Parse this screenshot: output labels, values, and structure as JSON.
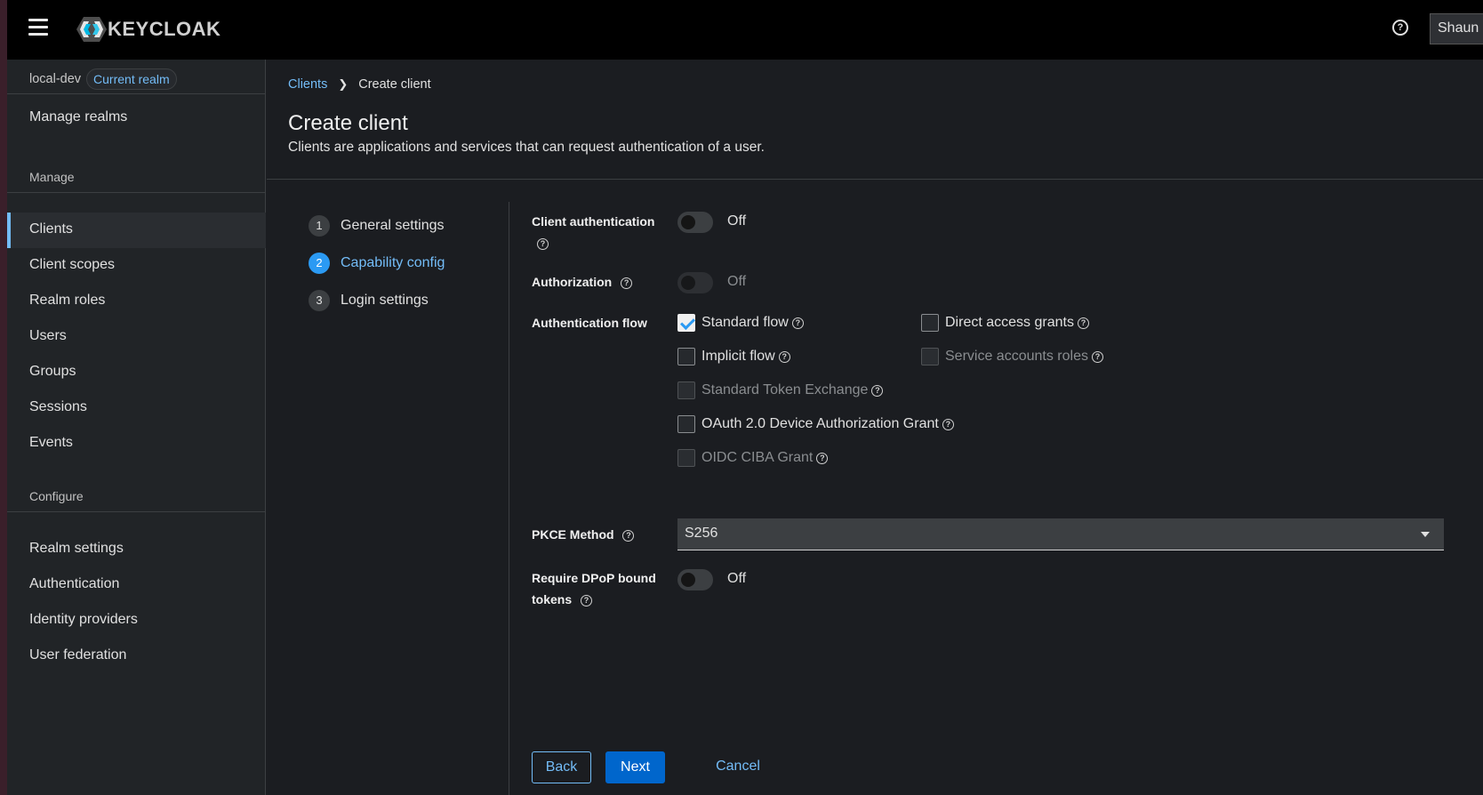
{
  "app": {
    "logo_text": "KEYCLOAK",
    "user_label": "Shaun M"
  },
  "sidebar": {
    "realm_name": "local-dev",
    "realm_badge": "Current realm",
    "manage_realms": "Manage realms",
    "section_manage": "Manage",
    "manage_items": [
      "Clients",
      "Client scopes",
      "Realm roles",
      "Users",
      "Groups",
      "Sessions",
      "Events"
    ],
    "active_item": "Clients",
    "section_configure": "Configure",
    "configure_items": [
      "Realm settings",
      "Authentication",
      "Identity providers",
      "User federation"
    ]
  },
  "breadcrumb": {
    "parent": "Clients",
    "current": "Create client"
  },
  "page": {
    "title": "Create client",
    "description": "Clients are applications and services that can request authentication of a user."
  },
  "wizard": {
    "steps": [
      {
        "num": "1",
        "label": "General settings"
      },
      {
        "num": "2",
        "label": "Capability config"
      },
      {
        "num": "3",
        "label": "Login settings"
      }
    ],
    "active_step": 2
  },
  "form": {
    "client_auth": {
      "label": "Client authentication",
      "state": "Off"
    },
    "authorization": {
      "label": "Authorization",
      "state": "Off"
    },
    "auth_flow": {
      "label": "Authentication flow",
      "standard_flow": {
        "label": "Standard flow",
        "checked": true
      },
      "direct_access": {
        "label": "Direct access grants",
        "checked": false
      },
      "implicit_flow": {
        "label": "Implicit flow",
        "checked": false
      },
      "service_accounts": {
        "label": "Service accounts roles",
        "checked": false
      },
      "token_exchange": {
        "label": "Standard Token Exchange",
        "checked": false
      },
      "device_grant": {
        "label": "OAuth 2.0 Device Authorization Grant",
        "checked": false
      },
      "ciba_grant": {
        "label": "OIDC CIBA Grant",
        "checked": false
      }
    },
    "pkce": {
      "label": "PKCE Method",
      "value": "S256"
    },
    "dpop": {
      "label_line1": "Require DPoP bound",
      "label_line2": "tokens",
      "state": "Off"
    }
  },
  "actions": {
    "back": "Back",
    "next": "Next",
    "cancel": "Cancel"
  }
}
